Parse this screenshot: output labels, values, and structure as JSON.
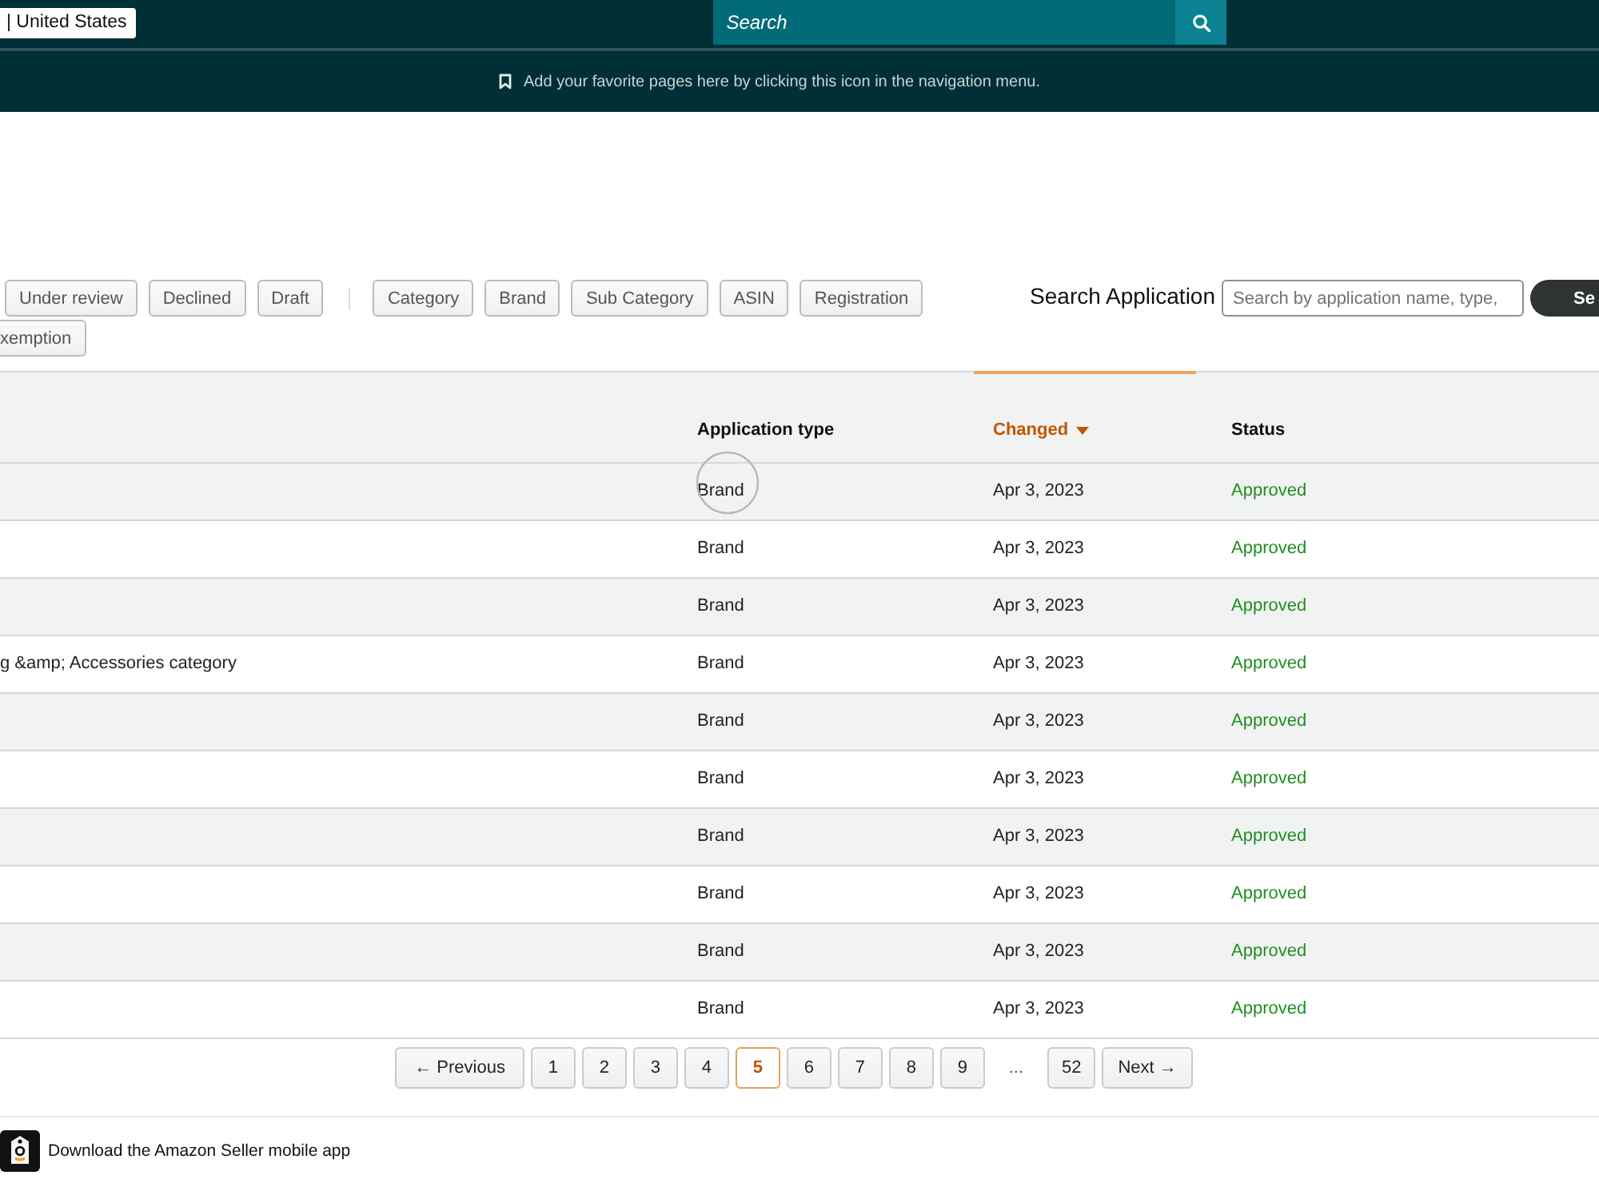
{
  "top_bar": {
    "marketplace": "| United States",
    "search": {
      "placeholder": "Search"
    }
  },
  "favorites_bar": {
    "message": "Add your favorite pages here by clicking this icon in the navigation menu."
  },
  "status_filters": [
    {
      "label": "Under review",
      "selected": false
    },
    {
      "label": "Declined",
      "selected": false
    },
    {
      "label": "Draft",
      "selected": false
    }
  ],
  "type_filters": [
    {
      "label": "Category",
      "selected": false
    },
    {
      "label": "Brand",
      "selected": false
    },
    {
      "label": "Sub Category",
      "selected": false
    },
    {
      "label": "ASIN",
      "selected": false
    },
    {
      "label": "Registration",
      "selected": false
    },
    {
      "label": "xemption",
      "selected": false
    }
  ],
  "application_search": {
    "label": "Search Application",
    "placeholder": "Search by application name, type,",
    "button": "Se"
  },
  "table": {
    "columns": [
      {
        "label": "Application type",
        "sorted": false
      },
      {
        "label": "Changed",
        "sorted": true
      },
      {
        "label": "Status",
        "sorted": false
      }
    ],
    "rows": [
      {
        "application_type": "Brand",
        "changed": "Apr 3, 2023",
        "status": "Approved"
      },
      {
        "application_type": "Brand",
        "changed": "Apr 3, 2023",
        "status": "Approved"
      },
      {
        "application_type": "Brand",
        "changed": "Apr 3, 2023",
        "status": "Approved"
      },
      {
        "column_1": "g &amp; Accessories category",
        "application_type": "Brand",
        "changed": "Apr 3, 2023",
        "status": "Approved"
      },
      {
        "application_type": "Brand",
        "changed": "Apr 3, 2023",
        "status": "Approved"
      },
      {
        "application_type": "Brand",
        "changed": "Apr 3, 2023",
        "status": "Approved"
      },
      {
        "application_type": "Brand",
        "changed": "Apr 3, 2023",
        "status": "Approved"
      },
      {
        "application_type": "Brand",
        "changed": "Apr 3, 2023",
        "status": "Approved"
      },
      {
        "application_type": "Brand",
        "changed": "Apr 3, 2023",
        "status": "Approved"
      },
      {
        "application_type": "Brand",
        "changed": "Apr 3, 2023",
        "status": "Approved"
      }
    ]
  },
  "pagination": [
    {
      "kind": "previous",
      "label": "← Previous"
    },
    {
      "kind": "page",
      "label": "1",
      "selected": false
    },
    {
      "kind": "page",
      "label": "2",
      "selected": false
    },
    {
      "kind": "page",
      "label": "3",
      "selected": false
    },
    {
      "kind": "page",
      "label": "4",
      "selected": false
    },
    {
      "kind": "page",
      "label": "5",
      "selected": true
    },
    {
      "kind": "page",
      "label": "6",
      "selected": false
    },
    {
      "kind": "page",
      "label": "7",
      "selected": false
    },
    {
      "kind": "page",
      "label": "8",
      "selected": false
    },
    {
      "kind": "page",
      "label": "9",
      "selected": false
    },
    {
      "kind": "gap",
      "label": "..."
    },
    {
      "kind": "page",
      "label": "52",
      "selected": false
    },
    {
      "kind": "next",
      "label": "Next →"
    }
  ],
  "footer": {
    "link": "Download the Amazon Seller mobile app"
  }
}
